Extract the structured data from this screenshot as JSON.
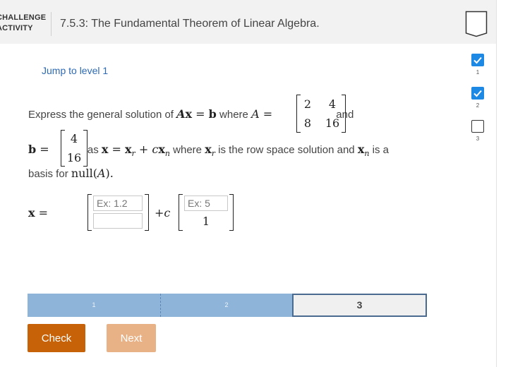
{
  "header": {
    "activity_label_line1": "CHALLENGE",
    "activity_label_line2": "ACTIVITY",
    "title": "7.5.3: The Fundamental Theorem of Linear Algebra."
  },
  "levels": [
    {
      "number": "1",
      "status": "completed"
    },
    {
      "number": "2",
      "status": "completed"
    },
    {
      "number": "3",
      "status": "current"
    }
  ],
  "jump_link": "Jump to level 1",
  "problem": {
    "line1_text_before": "Express the general solution of ",
    "line1_where": " where ",
    "line1_and": " and",
    "line2_as": " as ",
    "line2_where": " where ",
    "line2_row_space": " is the row space solution and ",
    "line2_is_a": " is a",
    "line3_basis_for": "basis for ",
    "matrix_A": [
      [
        "2",
        "4"
      ],
      [
        "8",
        "16"
      ]
    ],
    "vector_b": [
      "4",
      "16"
    ]
  },
  "answer": {
    "lhs": "x",
    "input1_placeholder": "Ex: 1.2",
    "input2_placeholder": "",
    "plus_c": "+c",
    "input3_placeholder": "Ex: 5",
    "fixed_entry": "1"
  },
  "progress": {
    "segments": [
      "1",
      "2",
      "3"
    ],
    "current": "3"
  },
  "buttons": {
    "check": "Check",
    "next": "Next"
  },
  "colors": {
    "primary_blue": "#1e88e5",
    "check_orange": "#c86208",
    "next_disabled": "#e8b286",
    "progress_fill": "#8fb4d9"
  }
}
